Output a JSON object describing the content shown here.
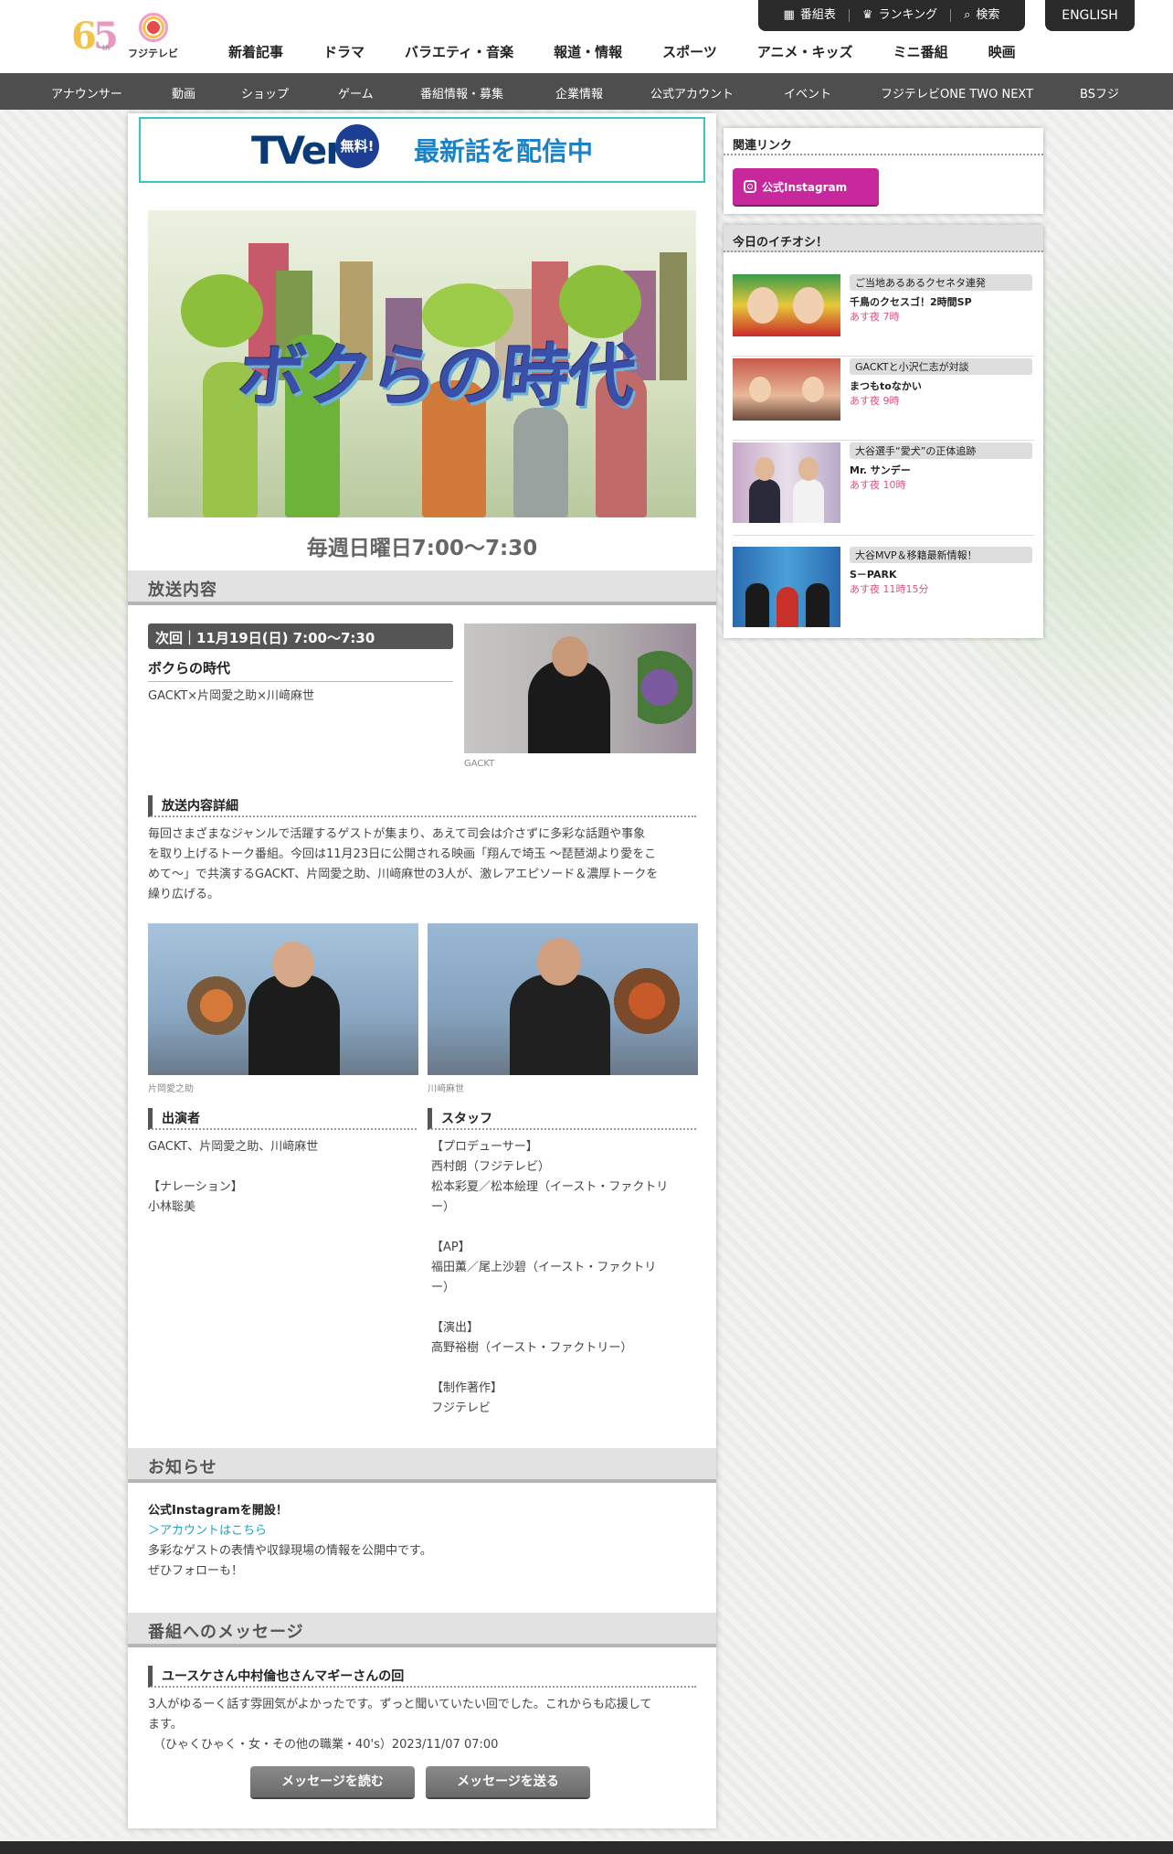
{
  "header": {
    "logo_text": "フジテレビ",
    "anniversary": "th",
    "topbar": [
      {
        "icon": "grid-icon",
        "label": "番組表"
      },
      {
        "icon": "crown-icon",
        "label": "ランキング"
      },
      {
        "icon": "search-icon",
        "label": "検索"
      }
    ],
    "english": "ENGLISH",
    "main_nav": [
      "新着記事",
      "ドラマ",
      "バラエティ・音楽",
      "報道・情報",
      "スポーツ",
      "アニメ・キッズ",
      "ミニ番組",
      "映画"
    ],
    "sub_nav": [
      "アナウンサー",
      "動画",
      "ショップ",
      "ゲーム",
      "番組情報・募集",
      "企業情報",
      "公式アカウント",
      "イベント",
      "フジテレビONE TWO NEXT",
      "BSフジ"
    ]
  },
  "tver": {
    "logo": "TVer",
    "free": "無料!",
    "message": "最新話を配信中"
  },
  "show": {
    "title": "ボクらの時代",
    "schedule": "毎週日曜日7:00〜7:30"
  },
  "broadcast": {
    "section_title": "放送内容",
    "next": "次回｜11月19日(日) 7:00〜7:30",
    "program": "ボクらの時代",
    "guests": "GACKT×片岡愛之助×川﨑麻世",
    "photo_caption_1": "GACKT",
    "detail_head": "放送内容詳細",
    "detail_lines": [
      "毎回さまざまなジャンルで活躍するゲストが集まり、あえて司会は介さずに多彩な話題や事象",
      "を取り上げるトーク番組。今回は11月23日に公開される映画「翔んで埼玉 〜琵琶湖より愛をこ",
      "めて〜」で共演するGACKT、片岡愛之助、川﨑麻世の3人が、激レアエピソード＆濃厚トークを",
      "繰り広げる。"
    ],
    "photo_caption_2": "片岡愛之助",
    "photo_caption_3": "川﨑麻世",
    "cast_head": "出演者",
    "cast_lines": [
      "GACKT、片岡愛之助、川﨑麻世",
      "",
      "【ナレーション】",
      "小林聡美"
    ],
    "staff_head": "スタッフ",
    "staff_lines": [
      "【プロデューサー】",
      "西村朗（フジテレビ）",
      "松本彩夏／松本絵理（イースト・ファクトリ",
      "ー）",
      "",
      "【AP】",
      "福田薫／尾上沙碧（イースト・ファクトリ",
      "ー）",
      "",
      "【演出】",
      "高野裕樹（イースト・ファクトリー）",
      "",
      "【制作著作】",
      "フジテレビ"
    ]
  },
  "news": {
    "section_title": "お知らせ",
    "headline": "公式Instagramを開設！",
    "link": "＞アカウントはこちら",
    "line1": "多彩なゲストの表情や収録現場の情報を公開中です。",
    "line2": "ぜひフォローも！"
  },
  "messages": {
    "section_title": "番組へのメッセージ",
    "head": "ユースケさん中村倫也さんマギーさんの回",
    "line1": "3人がゆるーく話す雰囲気がよかったです。ずっと聞いていたい回でした。これからも応援して",
    "line2": "ます。",
    "author": "（ひゃくひゃく・女・その他の職業・40's）2023/11/07 07:00",
    "read_btn": "メッセージを読む",
    "send_btn": "メッセージを送る"
  },
  "sidebar": {
    "related_title": "関連リンク",
    "instagram_btn": "公式Instagram",
    "pickup_title": "今日のイチオシ！",
    "picks": [
      {
        "tag": "ご当地あるあるクセネタ連発",
        "title": "千鳥のクセスゴ！2時間SP",
        "time": "あす夜 7時"
      },
      {
        "tag": "GACKTと小沢仁志が対談",
        "title": "まつもtoなかい",
        "time": "あす夜 9時"
      },
      {
        "tag": "大谷選手“愛犬”の正体追跡",
        "title": "Mr. サンデー",
        "time": "あす夜 10時"
      },
      {
        "tag": "大谷MVP＆移籍最新情報！",
        "title": "S－PARK",
        "time": "あす夜 11時15分"
      }
    ]
  },
  "colors": {
    "accent": "#3cc3c8",
    "instagram": "#c7289b",
    "nav_dark": "#4e4e4e",
    "time_pink": "#e0517a"
  }
}
